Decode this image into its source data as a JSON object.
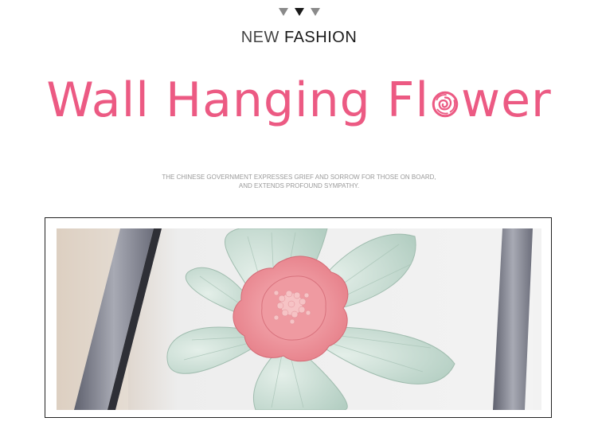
{
  "header": {
    "triangles": [
      "gray",
      "black",
      "gray"
    ],
    "subtitle_word1": "NEW",
    "subtitle_word2": "FASHION",
    "title_part1": "Wall Hanging Fl",
    "title_part2": "wer",
    "title_o_icon": "rose-icon",
    "disclaimer_line1": "THE CHINESE GOVERNMENT EXPRESSES GRIEF AND SORROW FOR THOSE ON BOARD,",
    "disclaimer_line2": "AND EXTENDS PROFOUND SYMPATHY."
  },
  "colors": {
    "accent_pink": "#ec5a83",
    "petal_mint": "#c5dcd2",
    "flower_pink": "#ec8d94",
    "frame_gray": "#8b8d99"
  },
  "photo": {
    "subject": "mint-green-and-pink-clay-flower-in-frame"
  }
}
